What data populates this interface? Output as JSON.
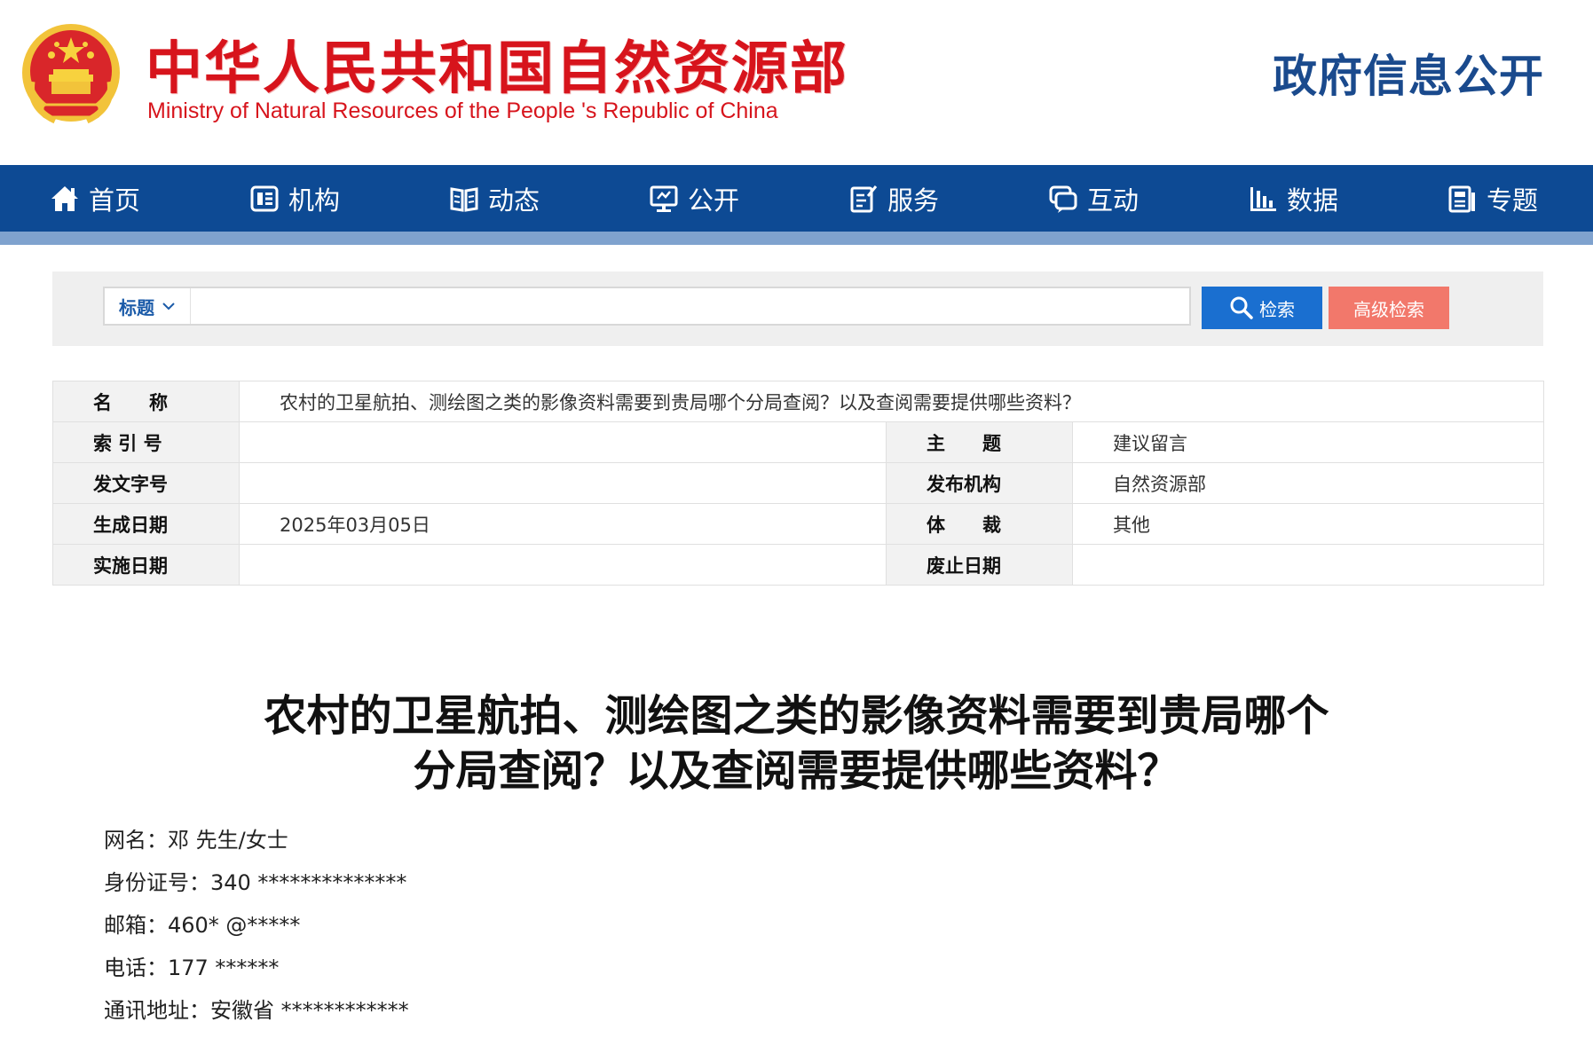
{
  "header": {
    "title_cn": "中华人民共和国自然资源部",
    "title_en": "Ministry of Natural Resources of the People 's Republic of China",
    "gov_open": "政府信息公开",
    "emblem_icon": "national-emblem-icon"
  },
  "nav": {
    "items": [
      {
        "label": "首页",
        "icon": "home-icon"
      },
      {
        "label": "机构",
        "icon": "organization-icon"
      },
      {
        "label": "动态",
        "icon": "book-icon"
      },
      {
        "label": "公开",
        "icon": "monitor-icon"
      },
      {
        "label": "服务",
        "icon": "edit-document-icon"
      },
      {
        "label": "互动",
        "icon": "chat-icon"
      },
      {
        "label": "数据",
        "icon": "bar-chart-icon"
      },
      {
        "label": "专题",
        "icon": "newspaper-icon"
      }
    ]
  },
  "search": {
    "field": "标题",
    "value": "",
    "search_label": "检索",
    "advanced_label": "高级检索"
  },
  "meta": {
    "name_label": "名　　称",
    "name_value": "农村的卫星航拍、测绘图之类的影像资料需要到贵局哪个分局查阅？以及查阅需要提供哪些资料？",
    "index_label": "索 引 号",
    "index_value": "",
    "topic_label": "主　　题",
    "topic_value": "建议留言",
    "docno_label": "发文字号",
    "docno_value": "",
    "issuer_label": "发布机构",
    "issuer_value": "自然资源部",
    "created_label": "生成日期",
    "created_value": "2025年03月05日",
    "genre_label": "体　　裁",
    "genre_value": "其他",
    "effective_label": "实施日期",
    "effective_value": "",
    "expire_label": "废止日期",
    "expire_value": ""
  },
  "article": {
    "title_line1": "农村的卫星航拍、测绘图之类的影像资料需要到贵局哪个",
    "title_line2": "分局查阅？以及查阅需要提供哪些资料？",
    "lines": [
      "网名：邓 先生/女士",
      "身份证号：340 **************",
      "邮箱：460* @*****",
      "电话：177 ******",
      "通讯地址：安徽省 ************"
    ]
  },
  "colors": {
    "brand_red": "#d7141c",
    "nav_blue": "#0d4a94",
    "search_blue": "#1a6fd0",
    "advanced_orange": "#f2786b"
  }
}
